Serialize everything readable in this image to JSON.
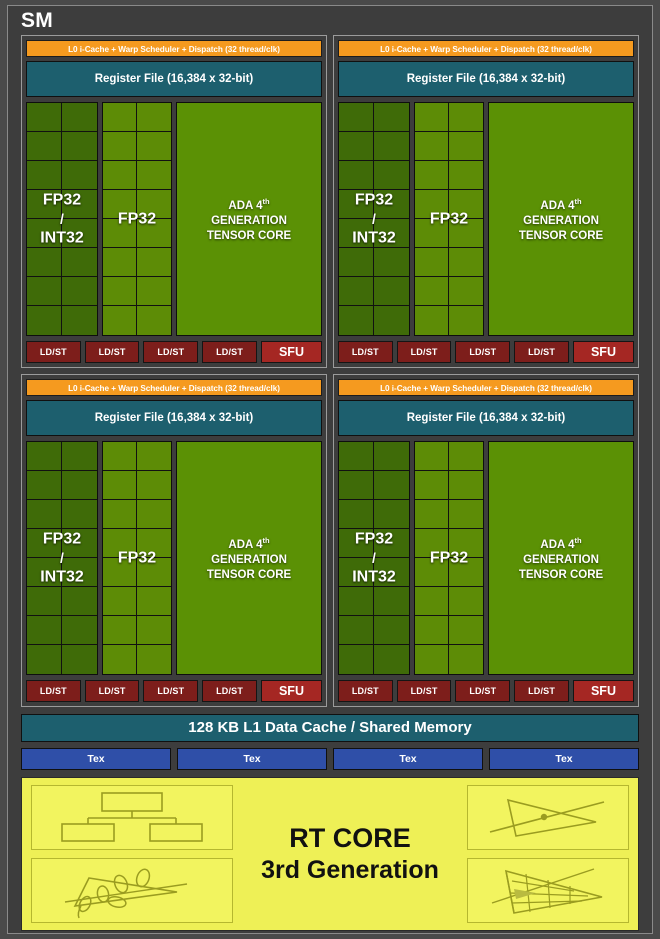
{
  "diagram": {
    "title": "SM",
    "quadrant": {
      "scheduler_label": "L0 i-Cache + Warp Scheduler + Dispatch (32 thread/clk)",
      "register_file_label": "Register File (16,384 x 32-bit)",
      "fp32_int32_label": {
        "line1": "FP32",
        "slash": "/",
        "line2": "INT32"
      },
      "fp32_label": "FP32",
      "tensor_core": {
        "line1_prefix": "ADA 4",
        "line1_sup": "th",
        "line2": "GENERATION",
        "line3": "TENSOR CORE"
      },
      "ldst_label": "LD/ST",
      "ldst_count": 4,
      "sfu_label": "SFU",
      "core_grid_rows": 8,
      "core_grid_cols": 2
    },
    "quadrant_count": 4,
    "l1_cache_label": "128 KB L1 Data Cache / Shared Memory",
    "tex_label": "Tex",
    "tex_count": 4,
    "rt_core": {
      "title_line1": "RT CORE",
      "title_line2": "3rd Generation",
      "icons": [
        "bvh-tree-icon",
        "ray-triangle-intersection-icon",
        "alpha-test-foliage-icon",
        "micro-mesh-displaced-triangle-icon"
      ]
    },
    "colors": {
      "background": "#3d3d3d",
      "scheduler": "#f59a1f",
      "register_file": "#1d5f6e",
      "fp32_int32": "#3f6b08",
      "fp32": "#5d8c06",
      "tensor_core": "#5b9105",
      "ldst": "#7d1e1b",
      "sfu": "#a52723",
      "tex": "#2f4fa8",
      "rt_core": "#eef056"
    }
  }
}
